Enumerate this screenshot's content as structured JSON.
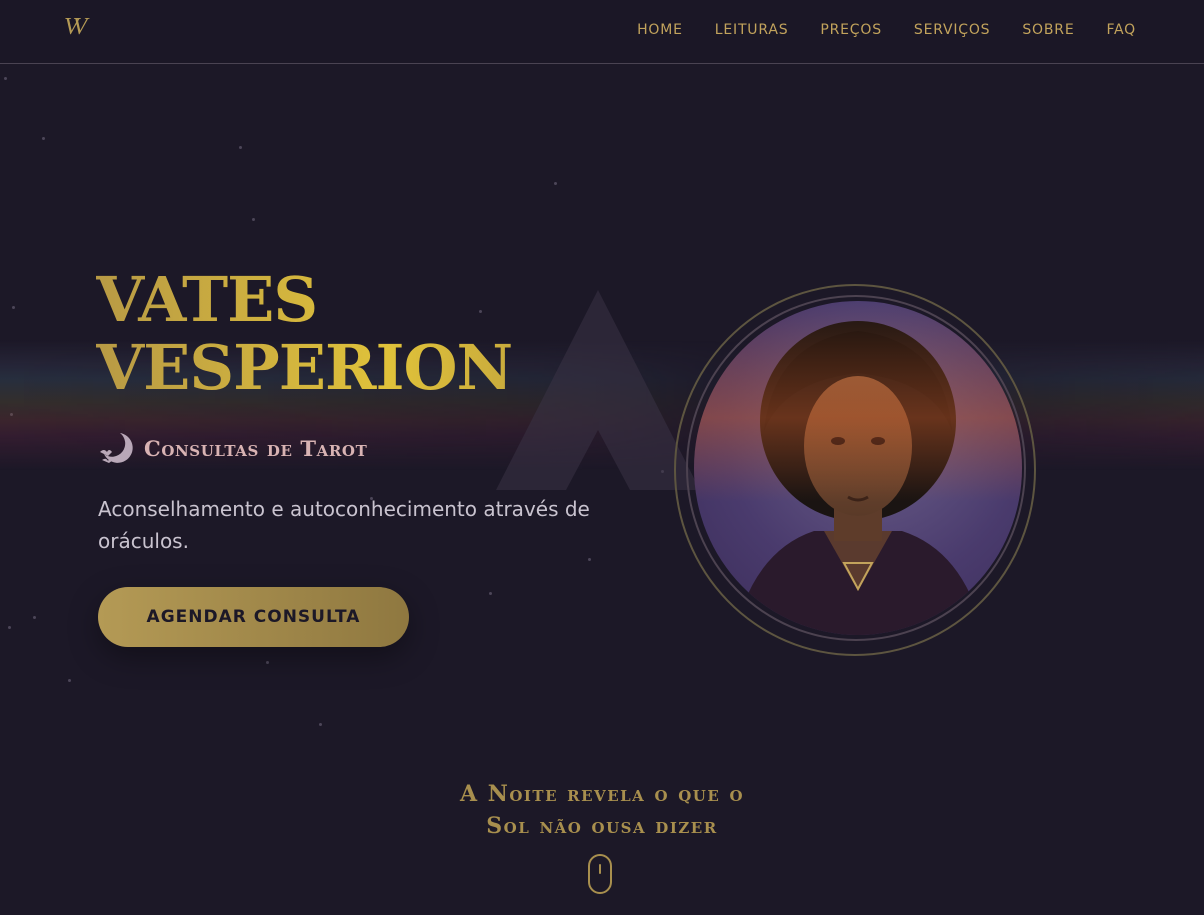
{
  "brand": {
    "logo_text": "VV",
    "accent_color": "#b49a55",
    "background_color": "#1c1827"
  },
  "nav": {
    "items": [
      "HOME",
      "LEITURAS",
      "PREÇOS",
      "SERVIÇOS",
      "SOBRE",
      "FAQ"
    ]
  },
  "hero": {
    "title_line1": "VATES",
    "title_line2": "VESPERION",
    "subtitle_icon": "crescent-moon-bat-icon",
    "subtitle": "Consultas de Tarot",
    "description": "Aconselhamento e autoconhecimento através de oráculos.",
    "cta_label": "AGENDAR CONSULTA",
    "portrait_alt": "portrait"
  },
  "tagline": {
    "line1": "A Noite revela o que o",
    "line2": "Sol não ousa dizer"
  },
  "scroll_indicator": "mouse-scroll-icon"
}
